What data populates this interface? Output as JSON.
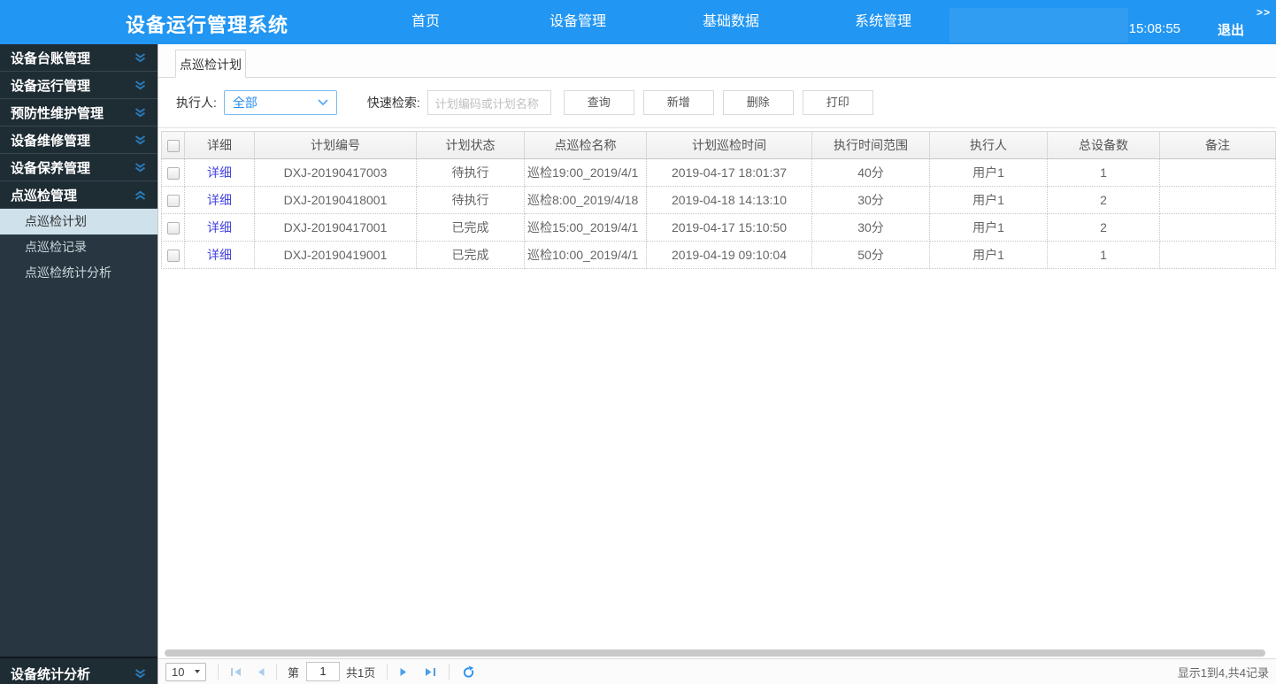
{
  "header": {
    "title": "设备运行管理系统",
    "nav": {
      "home": "首页",
      "equipment": "设备管理",
      "base": "基础数据",
      "system": "系统管理"
    },
    "time": "15:08:55",
    "logout": "退出",
    "collapse": ">>"
  },
  "sidebar": {
    "groups": [
      {
        "label": "设备台账管理"
      },
      {
        "label": "设备运行管理"
      },
      {
        "label": "预防性维护管理"
      },
      {
        "label": "设备维修管理"
      },
      {
        "label": "设备保养管理"
      },
      {
        "label": "点巡检管理",
        "children": [
          "点巡检计划",
          "点巡检记录",
          "点巡检统计分析"
        ]
      },
      {
        "label": "设备统计分析"
      }
    ]
  },
  "main": {
    "tab": "点巡检计划",
    "filter": {
      "executor_label": "执行人:",
      "executor_value": "全部",
      "search_label": "快速检索:",
      "search_placeholder": "计划编码或计划名称",
      "buttons": {
        "query": "查询",
        "add": "新增",
        "delete": "删除",
        "print": "打印"
      }
    },
    "table": {
      "columns": [
        "详细",
        "计划编号",
        "计划状态",
        "点巡检名称",
        "计划巡检时间",
        "执行时间范围",
        "执行人",
        "总设备数",
        "备注"
      ],
      "rows": [
        {
          "detail": "详细",
          "code": "DXJ-20190417003",
          "status": "待执行",
          "name": "巡检19:00_2019/4/1",
          "time": "2019-04-17 18:01:37",
          "range": "40分",
          "executor": "用户1",
          "count": "1",
          "remark": ""
        },
        {
          "detail": "详细",
          "code": "DXJ-20190418001",
          "status": "待执行",
          "name": "巡检8:00_2019/4/18",
          "time": "2019-04-18 14:13:10",
          "range": "30分",
          "executor": "用户1",
          "count": "2",
          "remark": ""
        },
        {
          "detail": "详细",
          "code": "DXJ-20190417001",
          "status": "已完成",
          "name": "巡检15:00_2019/4/1",
          "time": "2019-04-17 15:10:50",
          "range": "30分",
          "executor": "用户1",
          "count": "2",
          "remark": ""
        },
        {
          "detail": "详细",
          "code": "DXJ-20190419001",
          "status": "已完成",
          "name": "巡检10:00_2019/4/1",
          "time": "2019-04-19 09:10:04",
          "range": "50分",
          "executor": "用户1",
          "count": "1",
          "remark": ""
        }
      ]
    },
    "pagination": {
      "page_size": "10",
      "page_prefix": "第",
      "page_value": "1",
      "page_total": "共1页",
      "summary": "显示1到4,共4记录"
    }
  },
  "colors": {
    "header_blue": "#2196f3",
    "sidebar_dark": "#1e2c34",
    "submenu_dark": "#273641",
    "selected_item_bg": "#cfe1ea",
    "link_blue": "#4545e0",
    "select_border_blue": "#7cb9ef",
    "pager_icon_blue": "#49a0e8",
    "pager_icon_disabled": "#a9cdea"
  }
}
